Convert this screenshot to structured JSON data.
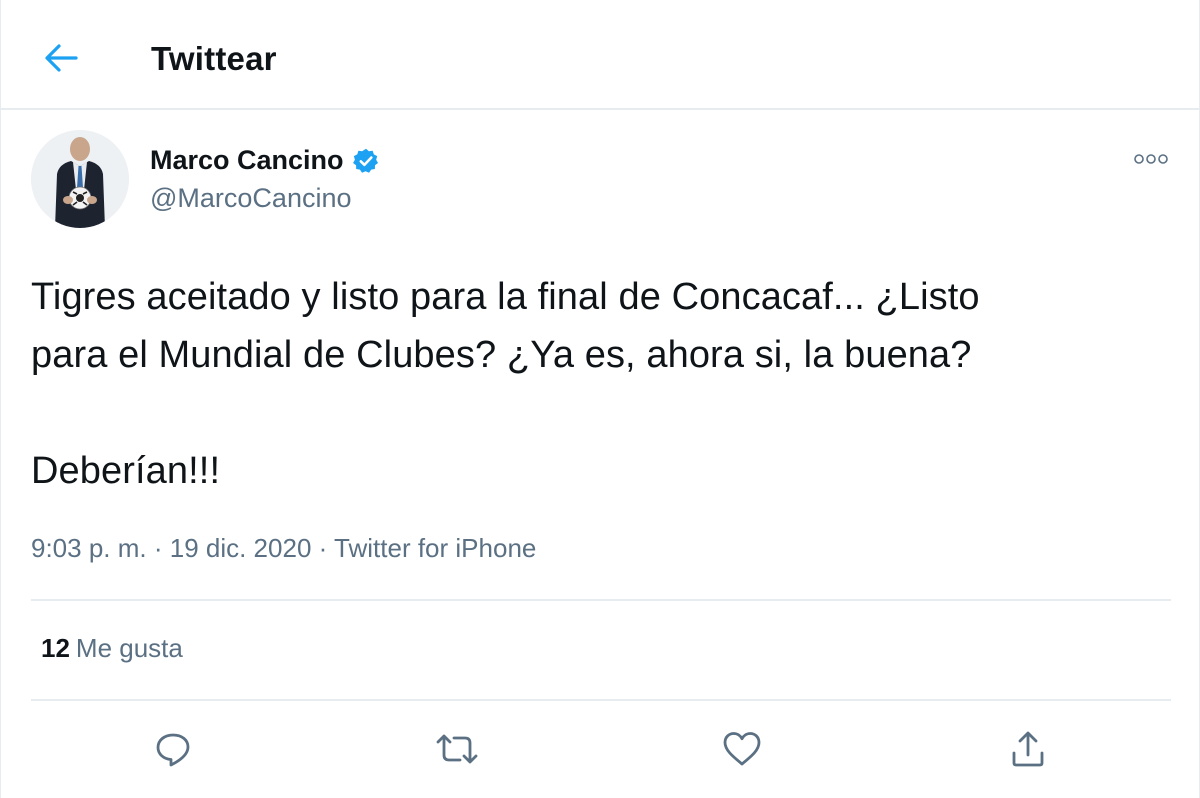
{
  "header": {
    "title": "Twittear",
    "back_icon": "arrow-left-icon",
    "accent_color": "#1da1f2"
  },
  "author": {
    "name": "Marco Cancino",
    "handle": "@MarcoCancino",
    "verified": true,
    "verified_icon": "verified-badge-icon"
  },
  "tweet": {
    "text": "Tigres aceitado y listo para la final de Concacaf... ¿Listo\npara el Mundial de Clubes? ¿Ya es, ahora si, la buena?\n\nDeberían!!!",
    "time": "9:03 p. m.",
    "separator": " · ",
    "date": "19 dic. 2020",
    "source": "Twitter for iPhone"
  },
  "stats": {
    "likes_count": "12",
    "likes_label": "Me gusta"
  },
  "actions": [
    {
      "name": "reply",
      "icon": "reply-icon"
    },
    {
      "name": "retweet",
      "icon": "retweet-icon"
    },
    {
      "name": "like",
      "icon": "heart-icon"
    },
    {
      "name": "share",
      "icon": "share-icon"
    }
  ],
  "colors": {
    "text_primary": "#0f1419",
    "text_secondary": "#5b7083",
    "divider": "#e6ecf0",
    "verified": "#1da1f2"
  }
}
